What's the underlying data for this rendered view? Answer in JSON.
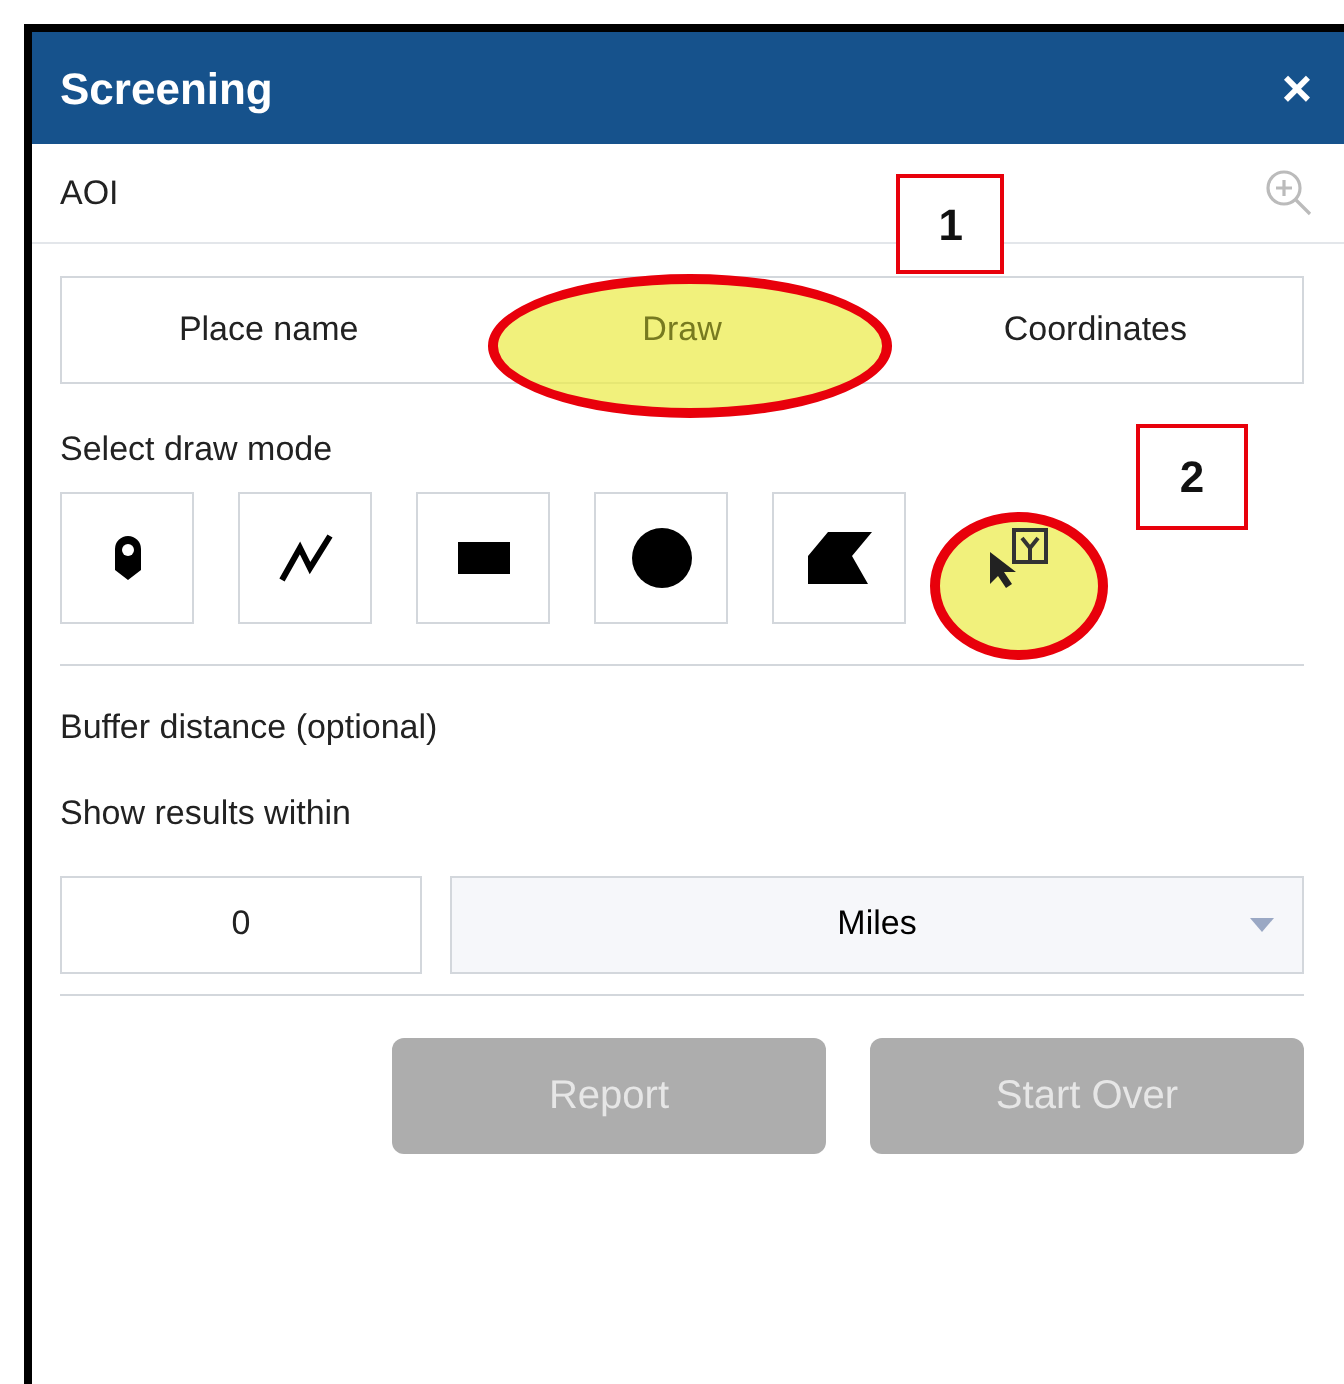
{
  "window": {
    "title": "Screening",
    "close": "×"
  },
  "aoi": {
    "label": "AOI"
  },
  "tabs": [
    {
      "label": "Place name",
      "selected": false,
      "highlighted": false
    },
    {
      "label": "Draw",
      "selected": true,
      "highlighted": true,
      "callout": "1"
    },
    {
      "label": "Coordinates",
      "selected": false,
      "highlighted": false
    }
  ],
  "draw_mode": {
    "label": "Select draw mode",
    "modes": [
      {
        "kind": "point",
        "highlighted": false
      },
      {
        "kind": "polyline",
        "highlighted": false
      },
      {
        "kind": "rectangle",
        "highlighted": false
      },
      {
        "kind": "circle",
        "highlighted": false
      },
      {
        "kind": "polygon",
        "highlighted": false
      },
      {
        "kind": "select",
        "highlighted": true,
        "callout": "2"
      }
    ]
  },
  "buffer": {
    "label": "Buffer distance (optional)",
    "sublabel": "Show results within",
    "value": "0",
    "unit": "Miles"
  },
  "buttons": [
    {
      "label": "Report",
      "disabled": true
    },
    {
      "label": "Start Over",
      "disabled": true
    }
  ]
}
